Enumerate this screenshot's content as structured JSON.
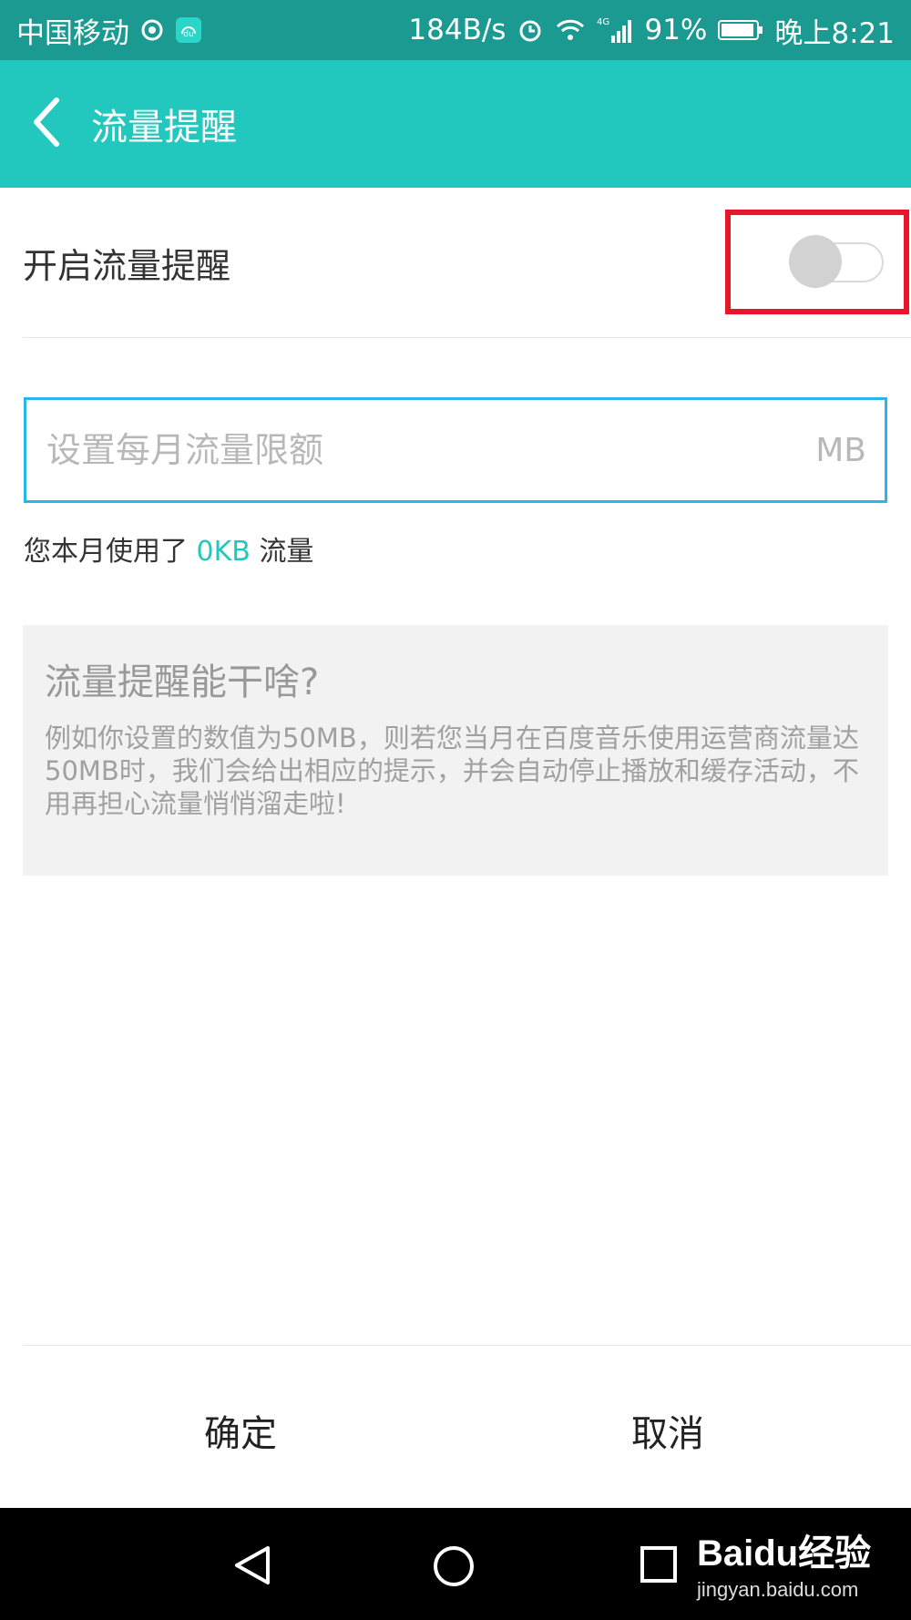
{
  "status_bar": {
    "carrier": "中国移动",
    "speed": "184B/s",
    "network": "4G",
    "battery": "91%",
    "time": "晚上8:21",
    "icons": [
      "notification-icon",
      "music-app-icon",
      "alarm-icon",
      "wifi-icon",
      "signal-icon",
      "battery-icon"
    ]
  },
  "app_bar": {
    "title": "流量提醒",
    "back_icon": "chevron-left-icon"
  },
  "toggle_row": {
    "label": "开启流量提醒",
    "enabled": false
  },
  "quota_input": {
    "placeholder": "设置每月流量限额",
    "value": "",
    "unit": "MB"
  },
  "usage": {
    "prefix": "您本月使用了",
    "value": "0KB",
    "suffix": "流量"
  },
  "info": {
    "title": "流量提醒能干啥?",
    "body": "例如你设置的数值为50MB，则若您当月在百度音乐使用运营商流量达50MB时，我们会给出相应的提示，并会自动停止播放和缓存活动，不用再担心流量悄悄溜走啦!"
  },
  "actions": {
    "confirm": "确定",
    "cancel": "取消"
  },
  "watermark": {
    "brand": "Baidu经验",
    "url": "jingyan.baidu.com"
  },
  "colors": {
    "status_bar": "#1a9a90",
    "app_bar": "#22c7bd",
    "accent": "#22c7bd",
    "input_border": "#29b6e8",
    "highlight": "#e8162b"
  }
}
